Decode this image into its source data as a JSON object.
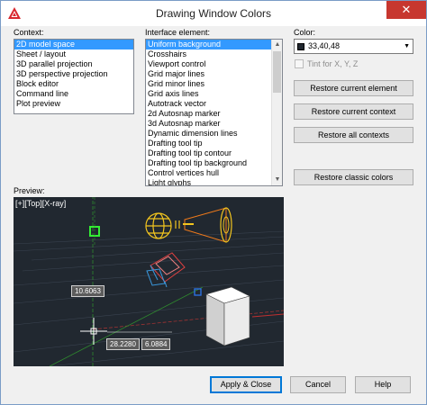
{
  "window": {
    "title": "Drawing Window Colors"
  },
  "context": {
    "label": "Context:",
    "items": [
      "2D model space",
      "Sheet / layout",
      "3D parallel projection",
      "3D perspective projection",
      "Block editor",
      "Command line",
      "Plot preview"
    ],
    "selected_index": 0
  },
  "interface": {
    "label": "Interface element:",
    "items": [
      "Uniform background",
      "Crosshairs",
      "Viewport control",
      "Grid major lines",
      "Grid minor lines",
      "Grid axis lines",
      "Autotrack vector",
      "2d Autosnap marker",
      "3d Autosnap marker",
      "Dynamic dimension lines",
      "Drafting tool tip",
      "Drafting tool tip contour",
      "Drafting tool tip background",
      "Control vertices hull",
      "Light glyphs"
    ],
    "selected_index": 0
  },
  "color": {
    "label": "Color:",
    "value": "33,40,48",
    "swatch": "#212830",
    "tint_label": "Tint for X, Y, Z"
  },
  "buttons": {
    "restore_element": "Restore current element",
    "restore_context": "Restore current context",
    "restore_all": "Restore all contexts",
    "restore_classic": "Restore classic colors",
    "apply_close": "Apply & Close",
    "cancel": "Cancel",
    "help": "Help"
  },
  "preview": {
    "label": "Preview:",
    "viewport_label": "[+][Top][X-ray]",
    "dim1": "10.6063",
    "dim2": "28.2280",
    "dim3": "6.0884",
    "background": "#212830"
  }
}
